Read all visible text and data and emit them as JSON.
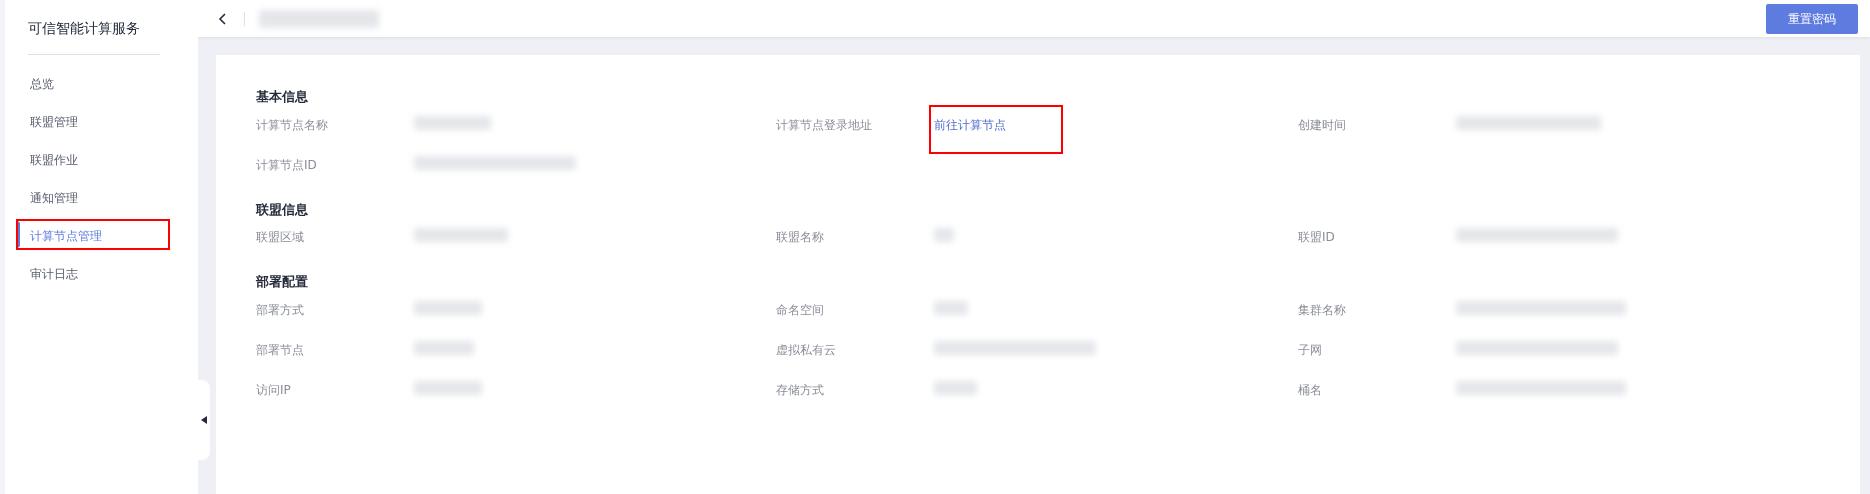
{
  "sidebar": {
    "title": "可信智能计算服务",
    "items": [
      {
        "label": "总览",
        "selected": false,
        "highlighted": false
      },
      {
        "label": "联盟管理",
        "selected": false,
        "highlighted": false
      },
      {
        "label": "联盟作业",
        "selected": false,
        "highlighted": false
      },
      {
        "label": "通知管理",
        "selected": false,
        "highlighted": false
      },
      {
        "label": "计算节点管理",
        "selected": true,
        "highlighted": true
      },
      {
        "label": "审计日志",
        "selected": false,
        "highlighted": false
      }
    ]
  },
  "header": {
    "title_redacted": true,
    "button": "重置密码"
  },
  "sections": [
    {
      "title": "基本信息",
      "rows": [
        [
          {
            "label": "计算节点名称",
            "kind": "redacted",
            "highlighted": false
          },
          {
            "label": "计算节点登录地址",
            "kind": "link",
            "value": "前往计算节点",
            "highlighted": true
          },
          {
            "label": "创建时间",
            "kind": "redacted",
            "highlighted": false
          }
        ],
        [
          {
            "label": "计算节点ID",
            "kind": "redacted",
            "highlighted": false
          }
        ]
      ]
    },
    {
      "title": "联盟信息",
      "rows": [
        [
          {
            "label": "联盟区域",
            "kind": "redacted",
            "highlighted": false
          },
          {
            "label": "联盟名称",
            "kind": "redacted",
            "highlighted": false
          },
          {
            "label": "联盟ID",
            "kind": "redacted",
            "highlighted": false
          }
        ]
      ]
    },
    {
      "title": "部署配置",
      "rows": [
        [
          {
            "label": "部署方式",
            "kind": "redacted",
            "highlighted": false
          },
          {
            "label": "命名空间",
            "kind": "redacted",
            "highlighted": false
          },
          {
            "label": "集群名称",
            "kind": "redacted",
            "highlighted": false
          }
        ],
        [
          {
            "label": "部署节点",
            "kind": "redacted",
            "highlighted": false
          },
          {
            "label": "虚拟私有云",
            "kind": "redacted",
            "highlighted": false
          },
          {
            "label": "子网",
            "kind": "redacted",
            "highlighted": false
          }
        ],
        [
          {
            "label": "访问IP",
            "kind": "redacted",
            "highlighted": false
          },
          {
            "label": "存储方式",
            "kind": "redacted",
            "highlighted": false
          },
          {
            "label": "桶名",
            "kind": "redacted",
            "highlighted": false
          }
        ]
      ]
    }
  ]
}
